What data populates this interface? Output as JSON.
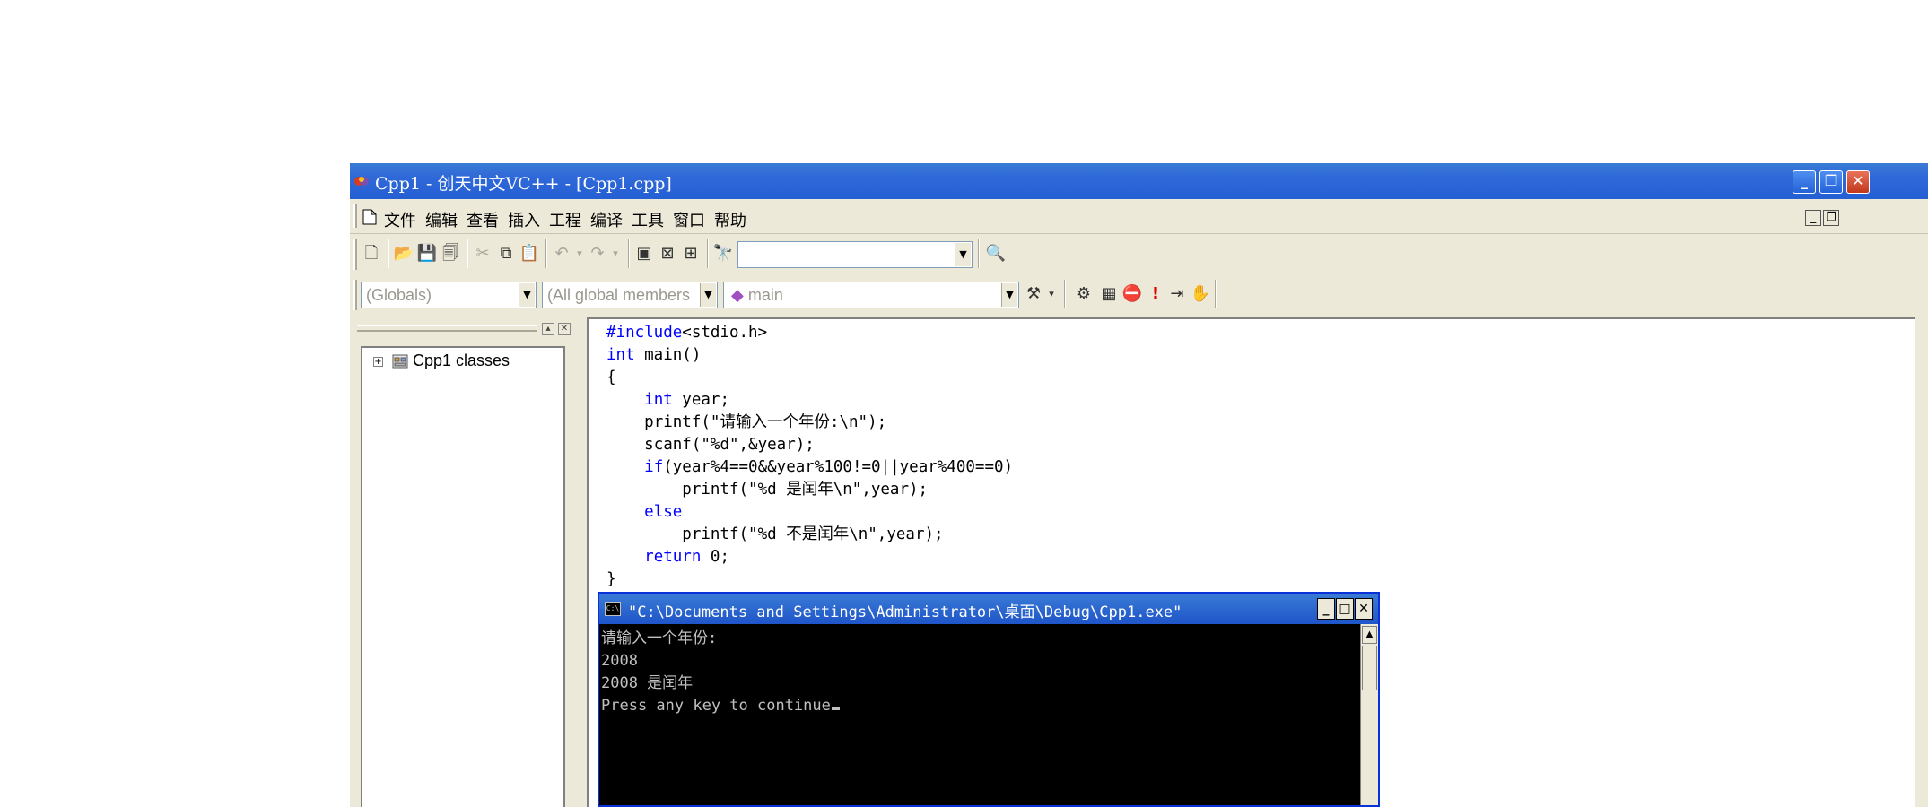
{
  "window": {
    "title": "Cpp1 - 创天中文VC++ - [Cpp1.cpp]",
    "title_color": "#2f68d8"
  },
  "menu": {
    "items": [
      "文件",
      "编辑",
      "查看",
      "插入",
      "工程",
      "编译",
      "工具",
      "窗口",
      "帮助"
    ]
  },
  "toolbar": {
    "find_combo_value": "",
    "icons": [
      "new-document",
      "open-folder",
      "save",
      "save-all",
      "cut",
      "copy",
      "paste",
      "undo",
      "redo",
      "workspace",
      "output",
      "window-list",
      "find-in-files",
      "find"
    ]
  },
  "wizardbar": {
    "class_combo": "(Globals)",
    "filter_combo": "(All global members",
    "member_combo": "main",
    "icons": [
      "wizard-action",
      "compile",
      "build",
      "stop-build",
      "execute",
      "go",
      "breakpoint"
    ]
  },
  "workspace": {
    "tree_root": "Cpp1 classes"
  },
  "editor": {
    "lines": [
      {
        "kw": "#include",
        "rest": "<stdio.h>",
        "indent": ""
      },
      {
        "kw": "int",
        "rest": " main()",
        "indent": ""
      },
      {
        "kw": "",
        "rest": "{",
        "indent": ""
      },
      {
        "kw": "int",
        "rest": " year;",
        "indent": "    "
      },
      {
        "kw": "",
        "rest": "printf(\"请输入一个年份:\\n\");",
        "indent": "    "
      },
      {
        "kw": "",
        "rest": "scanf(\"%d\",&year);",
        "indent": "    "
      },
      {
        "kw": "if",
        "rest": "(year%4==0&&year%100!=0||year%400==0)",
        "indent": "    "
      },
      {
        "kw": "",
        "rest": "printf(\"%d 是闰年\\n\",year);",
        "indent": "        "
      },
      {
        "kw": "else",
        "rest": "",
        "indent": "    "
      },
      {
        "kw": "",
        "rest": "printf(\"%d 不是闰年\\n\",year);",
        "indent": "        "
      },
      {
        "kw": "return",
        "rest": " 0;",
        "indent": "    "
      },
      {
        "kw": "",
        "rest": "}",
        "indent": ""
      }
    ],
    "keyword_color": "#0000ff"
  },
  "console": {
    "title": "\"C:\\Documents and Settings\\Administrator\\桌面\\Debug\\Cpp1.exe\"",
    "icon_label": "C:\\",
    "lines": [
      "请输入一个年份:",
      "2008",
      "2008 是闰年",
      "Press any key to continue"
    ]
  }
}
